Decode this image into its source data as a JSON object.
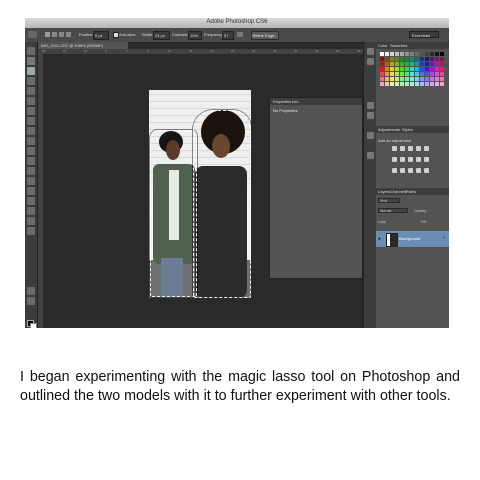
{
  "window": {
    "title": "Adobe Photoshop CS6",
    "traffic_colors": [
      "#fc605c",
      "#fdbc40",
      "#34c84a"
    ]
  },
  "options_bar": {
    "feather_label": "Feather:",
    "feather_value": "0 px",
    "anti_alias_label": "Anti-alias",
    "width_label": "Width:",
    "width_value": "24 px",
    "contrast_label": "Contrast:",
    "contrast_value": "10%",
    "frequency_label": "Frequency:",
    "frequency_value": "57",
    "refine_edge_label": "Refine Edge...",
    "workspace_label": "Essentials"
  },
  "document": {
    "tab_label": "IMG_0111.CR2 @ 8.88% (RGB/8*)",
    "ruler_ticks": [
      "20",
      "15",
      "10",
      "5",
      "0",
      "5",
      "10",
      "15",
      "20",
      "25",
      "30",
      "35",
      "40",
      "45",
      "50",
      "55"
    ]
  },
  "properties_panel": {
    "tabs": [
      "Properties",
      "Info"
    ],
    "message": "No Properties"
  },
  "swatches_panel": {
    "tabs": [
      "Color",
      "Swatches"
    ]
  },
  "adjustments_panel": {
    "tabs": [
      "Adjustments",
      "Styles"
    ],
    "title": "Add an adjustment"
  },
  "layers_panel": {
    "tabs": [
      "Layers",
      "Channels",
      "Paths"
    ],
    "kind_label": "Kind",
    "blend_mode": "Normal",
    "opacity_label": "Opacity:",
    "lock_label": "Lock:",
    "fill_label": "Fill:",
    "layer_name": "Background"
  },
  "caption": "I began experimenting with the magic lasso tool on Photoshop and outlined the two models with it to further experiment with other tools."
}
